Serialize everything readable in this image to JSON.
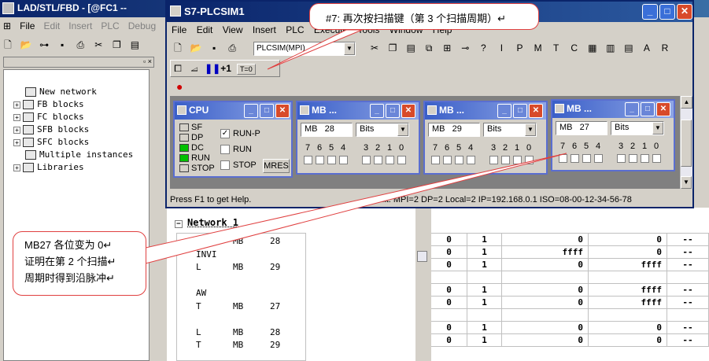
{
  "bg_window": {
    "title": "LAD/STL/FBD  - [@FC1 --",
    "menu": [
      "File",
      "Edit",
      "Insert",
      "PLC",
      "Debug"
    ]
  },
  "tree": {
    "items": [
      {
        "label": "New network",
        "expandable": false
      },
      {
        "label": "FB blocks",
        "expandable": true
      },
      {
        "label": "FC blocks",
        "expandable": true
      },
      {
        "label": "SFB blocks",
        "expandable": true
      },
      {
        "label": "SFC blocks",
        "expandable": true
      },
      {
        "label": "Multiple instances",
        "expandable": false
      },
      {
        "label": "Libraries",
        "expandable": true
      }
    ]
  },
  "plcsim": {
    "title": "S7-PLCSIM1",
    "menu": [
      "File",
      "Edit",
      "View",
      "Insert",
      "PLC",
      "Execute",
      "Tools",
      "Window",
      "Help"
    ],
    "plc_select": "PLCSIM(MPI)",
    "scan_step": "+1",
    "scan_t": "T=0",
    "status": "Press F1 to get Help.",
    "status_right": "ault:   MPI=2 DP=2 Local=2 IP=192.168.0.1 ISO=08-00-12-34-56-78"
  },
  "cpu_window": {
    "title": "CPU",
    "leds": [
      {
        "label": "SF",
        "on": false
      },
      {
        "label": "DP",
        "on": false
      },
      {
        "label": "DC",
        "on": true
      },
      {
        "label": "RUN",
        "on": true
      },
      {
        "label": "STOP",
        "on": false
      }
    ],
    "modes": [
      {
        "label": "RUN-P",
        "checked": true
      },
      {
        "label": "RUN",
        "checked": false
      },
      {
        "label": "STOP",
        "checked": false
      }
    ],
    "mres": "MRES"
  },
  "mb_windows": [
    {
      "title": "MB   ...",
      "area": "MB",
      "addr": "28",
      "fmt": "Bits"
    },
    {
      "title": "MB   ...",
      "area": "MB",
      "addr": "29",
      "fmt": "Bits"
    },
    {
      "title": "MB   ...",
      "area": "MB",
      "addr": "27",
      "fmt": "Bits"
    }
  ],
  "bit_labels": [
    "7",
    "6",
    "5",
    "4",
    "3",
    "2",
    "1",
    "0"
  ],
  "code": {
    "network_label": "Network 1",
    "network_title_suffix": ":",
    "lines": [
      [
        "L",
        "MB",
        "28"
      ],
      [
        "INVI",
        "",
        ""
      ],
      [
        "L",
        "MB",
        "29"
      ],
      [
        "",
        "",
        ""
      ],
      [
        "AW",
        "",
        ""
      ],
      [
        "T",
        "MB",
        "27"
      ],
      [
        "",
        "",
        ""
      ],
      [
        "L",
        "MB",
        "28"
      ],
      [
        "T",
        "MB",
        "29"
      ]
    ]
  },
  "table": {
    "rows": [
      [
        "0",
        "1",
        "0",
        "0",
        "--"
      ],
      [
        "0",
        "1",
        "ffff",
        "0",
        "--"
      ],
      [
        "0",
        "1",
        "0",
        "ffff",
        "--"
      ],
      [
        "",
        "",
        "",
        "",
        ""
      ],
      [
        "0",
        "1",
        "0",
        "ffff",
        "--"
      ],
      [
        "0",
        "1",
        "0",
        "ffff",
        "--"
      ],
      [
        "",
        "",
        "",
        "",
        ""
      ],
      [
        "0",
        "1",
        "0",
        "0",
        "--"
      ],
      [
        "0",
        "1",
        "0",
        "0",
        "--"
      ]
    ]
  },
  "callouts": {
    "top": "#7: 再次按扫描键（第 3 个扫描周期）↵",
    "left_lines": [
      "MB27 各位变为 0↵",
      "证明在第 2 个扫描↵",
      "周期时得到沿脉冲↵"
    ]
  },
  "colors": {
    "title_blue": "#0a246a",
    "led_green": "#00c000",
    "callout_border": "#e04040"
  }
}
